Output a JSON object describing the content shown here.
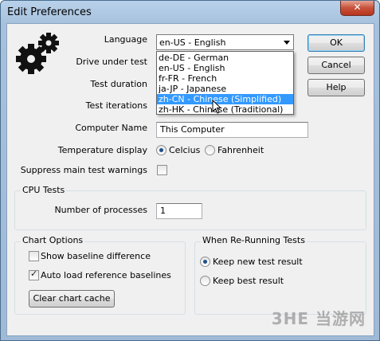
{
  "window": {
    "title": "Edit Preferences",
    "close_glyph": "✕"
  },
  "buttons": {
    "ok": "OK",
    "cancel": "Cancel",
    "help": "Help",
    "clear_cache": "Clear chart cache"
  },
  "labels": {
    "language": "Language",
    "drive": "Drive under test",
    "duration": "Test duration",
    "iterations": "Test iterations",
    "computer_name": "Computer Name",
    "temperature": "Temperature display",
    "suppress": "Suppress main test warnings"
  },
  "language": {
    "selected": "en-US - English",
    "options": [
      "de-DE - German",
      "en-US - English",
      "fr-FR - French",
      "ja-JP - Japanese",
      "zh-CN - Chinese (Simplified)",
      "zh-HK - Chinese (Traditional)"
    ],
    "highlighted": "zh-CN - Chinese (Simplified)"
  },
  "computer_name_value": "This Computer",
  "temperature": {
    "celcius": "Celcius",
    "fahrenheit": "Fahrenheit",
    "selected": "Celcius"
  },
  "suppress_checked": false,
  "cpu_tests": {
    "title": "CPU Tests",
    "processes_label": "Number of processes",
    "processes_value": "1"
  },
  "chart_options": {
    "title": "Chart Options",
    "show_baseline": "Show baseline difference",
    "show_baseline_checked": false,
    "auto_load": "Auto load reference baselines",
    "auto_load_checked": true
  },
  "rerun": {
    "title": "When Re-Running Tests",
    "keep_new": "Keep new test result",
    "keep_best": "Keep best result",
    "selected": "Keep new test result"
  },
  "watermark": "3HE 当游网",
  "colors": {
    "highlight": "#3399ff",
    "default_button_border": "#3c7fb1",
    "title_bar": "#b9d1ea"
  },
  "icons": {
    "gears": "gears-icon"
  }
}
